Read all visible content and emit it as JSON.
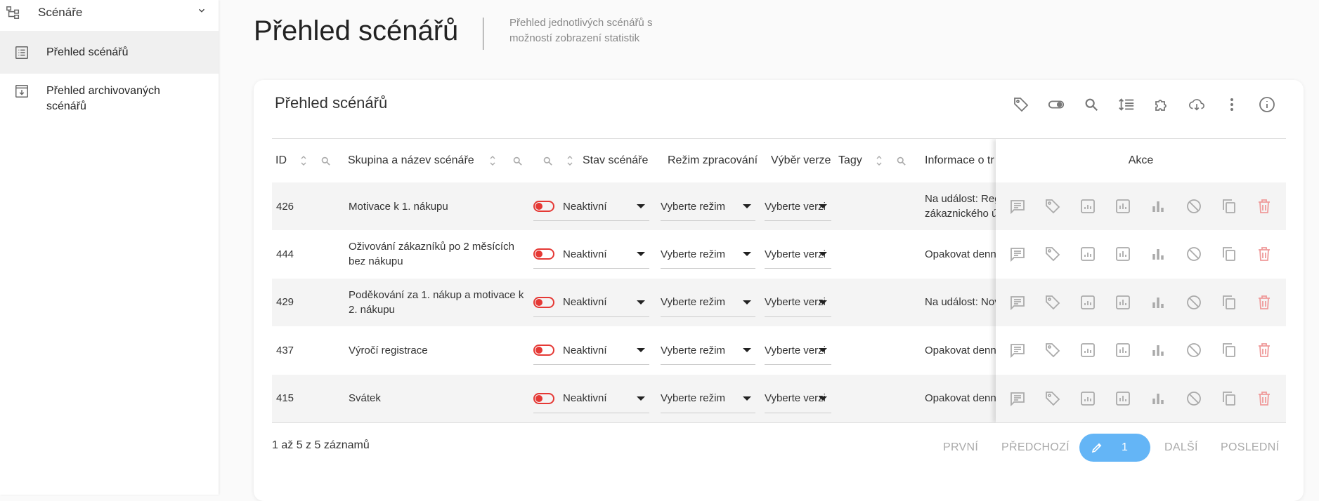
{
  "sidebar": {
    "group_label": "Scénáře",
    "items": [
      {
        "label": "Přehled scénářů"
      },
      {
        "label_line1": "Přehled archivovaných",
        "label_line2": "scénářů"
      }
    ]
  },
  "header": {
    "title": "Přehled scénářů",
    "description_line1": "Přehled jednotlivých scénářů s",
    "description_line2": "možností zobrazení statistik"
  },
  "card": {
    "title": "Přehled scénářů",
    "toolbar": [
      "tag-icon",
      "toggle-icon",
      "search-icon",
      "line-spacing-icon",
      "extension-icon",
      "cloud-download-icon",
      "more-vert-icon",
      "info-icon"
    ]
  },
  "table": {
    "headers": {
      "id": "ID",
      "name": "Skupina a název scénáře",
      "status": "Stav scénáře",
      "mode": "Režim zpracování",
      "version": "Výběr verze",
      "tags": "Tagy",
      "info": "Informace o tr",
      "actions": "Akce"
    },
    "rows": [
      {
        "id": "426",
        "name": "Motivace k 1. nákupu",
        "status": "Neaktivní",
        "mode": "Vyberte režim",
        "version": "Vyberte verzi",
        "info_line1": "Na událost: Reg",
        "info_line2": "zákaznického úč"
      },
      {
        "id": "444",
        "name": "Oživování zákazníků po 2 měsících bez nákupu",
        "status": "Neaktivní",
        "mode": "Vyberte režim",
        "version": "Vyberte verzi",
        "info_line1": "Opakovat denně",
        "info_line2": ""
      },
      {
        "id": "429",
        "name": "Poděkování za 1. nákup a motivace k 2. nákupu",
        "status": "Neaktivní",
        "mode": "Vyberte režim",
        "version": "Vyberte verzi",
        "info_line1": "Na událost: Nov",
        "info_line2": ""
      },
      {
        "id": "437",
        "name": "Výročí registrace",
        "status": "Neaktivní",
        "mode": "Vyberte režim",
        "version": "Vyberte verzi",
        "info_line1": "Opakovat denně",
        "info_line2": ""
      },
      {
        "id": "415",
        "name": "Svátek",
        "status": "Neaktivní",
        "mode": "Vyberte režim",
        "version": "Vyberte verzi",
        "info_line1": "Opakovat denně",
        "info_line2": ""
      }
    ],
    "action_icons": [
      "comment-icon",
      "tag-icon",
      "report-icon",
      "stats-icon",
      "bar-chart-icon",
      "block-icon",
      "copy-icon",
      "delete-icon"
    ]
  },
  "footer": {
    "records": "1 až 5 z 5 záznamů",
    "first": "PRVNÍ",
    "prev": "PŘEDCHOZÍ",
    "current": "1",
    "next": "DALŠÍ",
    "last": "POSLEDNÍ"
  },
  "colors": {
    "accent": "#64b5f6",
    "inactive_toggle": "#e53935",
    "delete": "#ef9a9a"
  }
}
